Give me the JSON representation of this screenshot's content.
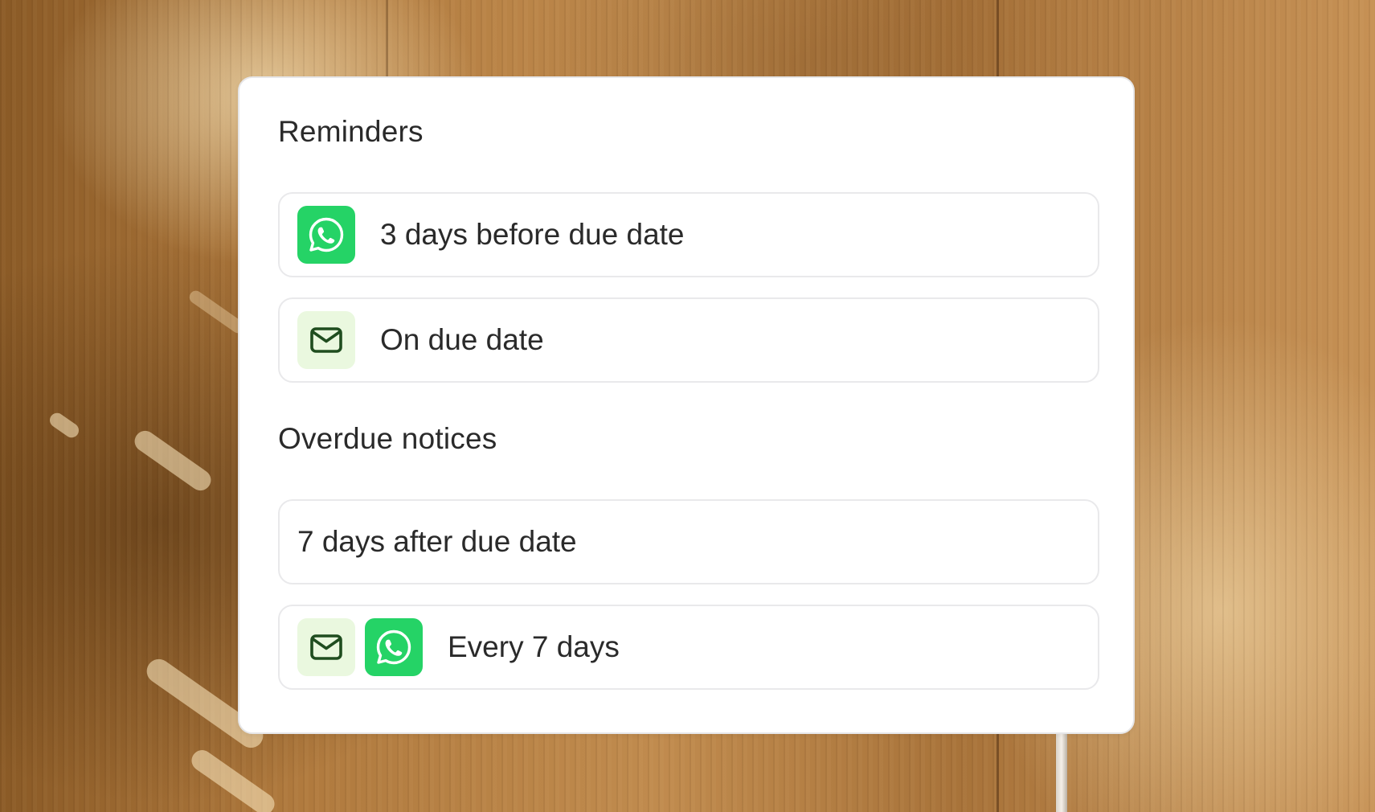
{
  "colors": {
    "whatsapp_green": "#25d366",
    "mail_tile_bg": "#eaf8df",
    "mail_icon_stroke": "#1f4d1f",
    "card_bg": "#ffffff",
    "row_border": "#e9e9eb",
    "text": "#2a2a2a"
  },
  "reminders": {
    "title": "Reminders",
    "items": [
      {
        "label": "3 days before due date",
        "icons": [
          "whatsapp-icon"
        ]
      },
      {
        "label": "On due date",
        "icons": [
          "mail-icon"
        ]
      }
    ]
  },
  "overdue": {
    "title": "Overdue notices",
    "items": [
      {
        "label": "7 days after due date",
        "icons": []
      },
      {
        "label": "Every 7 days",
        "icons": [
          "mail-icon",
          "whatsapp-icon"
        ]
      }
    ]
  }
}
